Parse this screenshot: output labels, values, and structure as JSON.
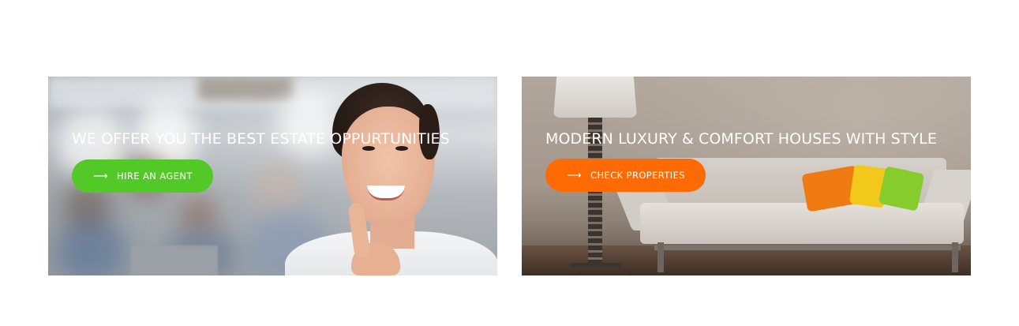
{
  "banners": [
    {
      "title": "WE OFFER YOU THE BEST ESTATE OPPURTUNITIES",
      "button_label": "HIRE AN AGENT",
      "button_icon": "arrow-right-icon",
      "button_color": "#52c926"
    },
    {
      "title": "MODERN LUXURY & COMFORT HOUSES WITH STYLE",
      "button_label": "CHECK PROPERTIES",
      "button_icon": "arrow-right-icon",
      "button_color": "#fe6b05"
    }
  ],
  "colors": {
    "text": "#ffffff",
    "page_background": "#ffffff"
  }
}
